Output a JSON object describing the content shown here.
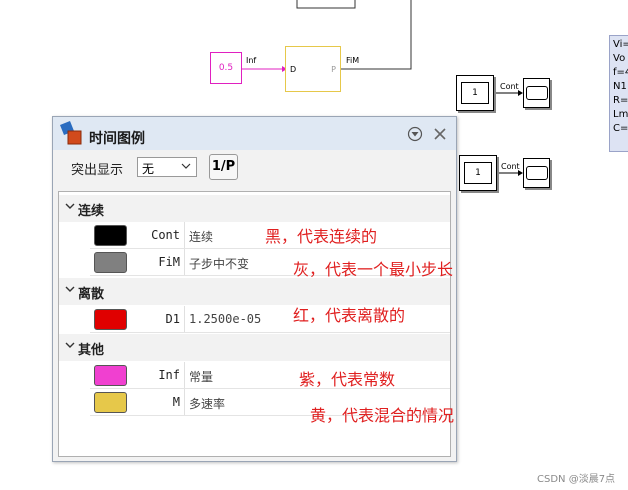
{
  "canvas": {
    "const_block": {
      "value": "0.5"
    },
    "signal_inf_label": "Inf",
    "subsystem": {
      "port_d": "D",
      "port_p": "P"
    },
    "signal_fim_label": "FiM",
    "const_1_top": {
      "value": "1"
    },
    "const_1_bottom": {
      "value": "1"
    },
    "signal_cont_top": "Cont",
    "signal_cont_bottom": "Cont",
    "param_panel": {
      "lines": [
        "Vi=",
        "Vo",
        "f=4",
        "N1",
        "R=",
        "Lm",
        "C="
      ]
    }
  },
  "dialog": {
    "title": "时间图例",
    "highlight_label": "突出显示",
    "highlight_value": "无",
    "point_button_label": "1/P",
    "sections": [
      {
        "label": "连续",
        "rows": [
          {
            "name": "Cont",
            "desc": "连续",
            "color": "#000000"
          },
          {
            "name": "FiM",
            "desc": "子步中不变",
            "color": "#808080"
          }
        ]
      },
      {
        "label": "离散",
        "rows": [
          {
            "name": "D1",
            "desc": "1.2500e-05",
            "color": "#e00000"
          }
        ]
      },
      {
        "label": "其他",
        "rows": [
          {
            "name": "Inf",
            "desc": "常量",
            "color": "#f040d0"
          },
          {
            "name": "M",
            "desc": "多速率",
            "color": "#e6c84a"
          }
        ]
      }
    ]
  },
  "annotations": [
    "黑，代表连续的",
    "灰，代表一个最小步长",
    "红，代表离散的",
    "紫，代表常数",
    "黄，代表混合的情况"
  ],
  "watermark": "CSDN @淡晨7点"
}
